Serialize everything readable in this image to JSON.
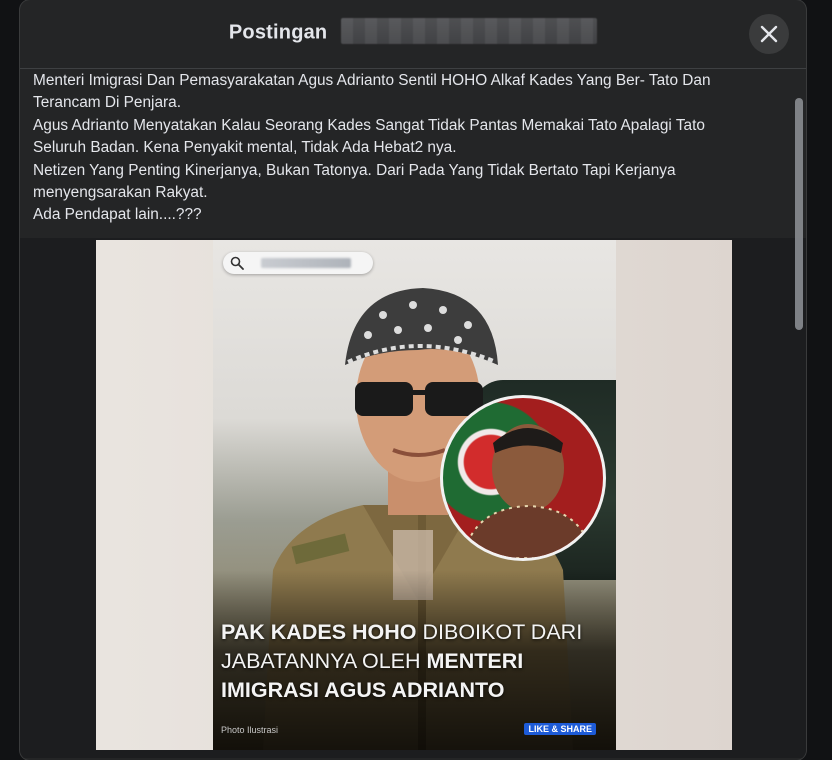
{
  "header": {
    "title": "Postingan",
    "close_icon": "close-icon"
  },
  "post": {
    "lines": [
      "Menteri Imigrasi Dan Pemasyarakatan Agus Adrianto Sentil HOHO Alkaf Kades Yang Ber- Tato Dan",
      "Terancam Di Penjara.",
      "Agus Adrianto Menyatakan Kalau Seorang Kades Sangat Tidak Pantas Memakai Tato Apalagi Tato",
      "Seluruh Badan. Kena Penyakit mental, Tidak Ada Hebat2 nya.",
      "Netizen Yang Penting Kinerjanya, Bukan Tatonya. Dari Pada Yang Tidak Bertato Tapi Kerjanya",
      "menyengsarakan Rakyat.",
      "Ada Pendapat lain....???"
    ]
  },
  "image": {
    "headline_bold_1": "PAK KADES HOHO",
    "headline_light_1": " DIBOIKOT DARI",
    "headline_light_2": "JABATANNYA OLEH ",
    "headline_bold_2": "MENTERI",
    "headline_bold_3": "IMIGRASI AGUS ADRIANTO",
    "caption_left": "Photo Ilustrasi",
    "caption_right": "LIKE & SHARE",
    "search_icon": "search-icon"
  },
  "colors": {
    "modal_bg": "#242526",
    "page_bg": "#111214",
    "text": "#e4e6eb",
    "close_bg": "#3a3b3c"
  }
}
